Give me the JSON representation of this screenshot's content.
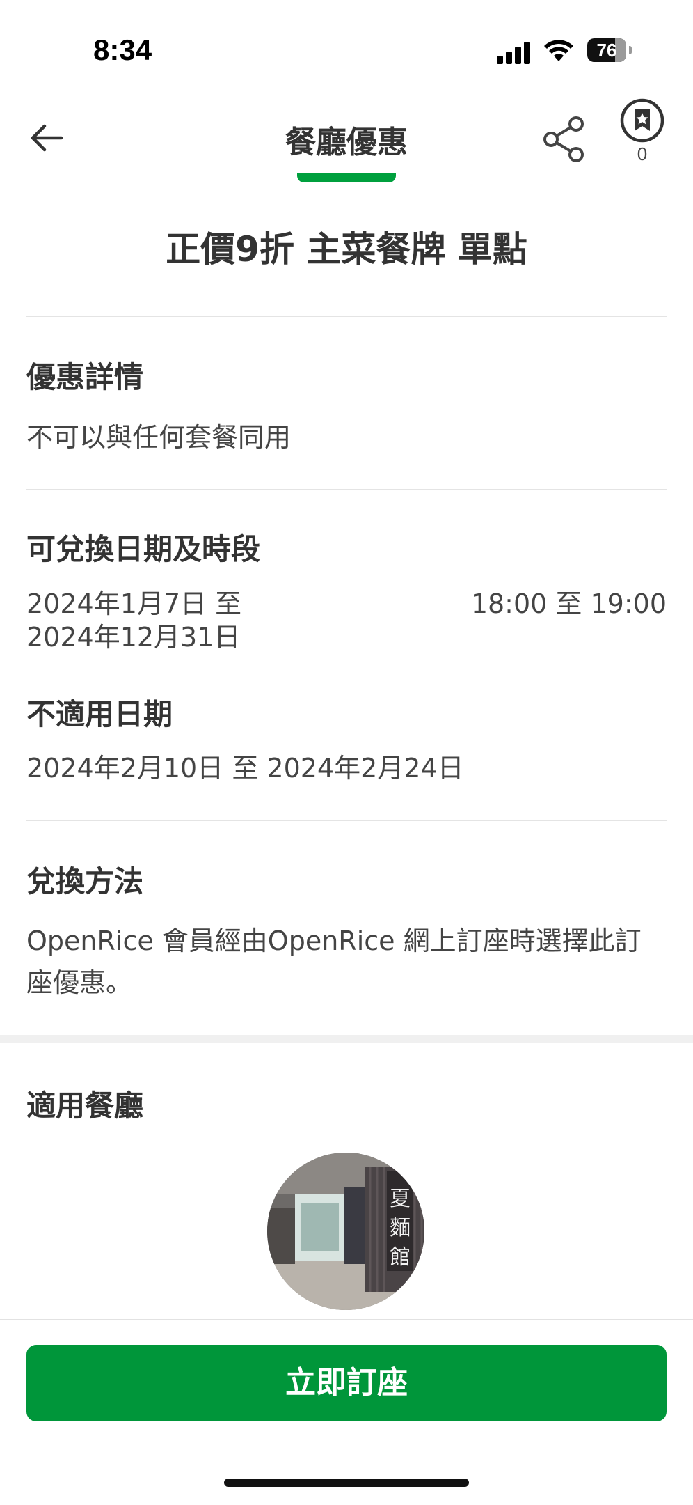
{
  "status_bar": {
    "time": "8:34",
    "battery": "76"
  },
  "nav": {
    "title": "餐廳優惠",
    "bookmark_count": "0"
  },
  "offer": {
    "title": "正價9折 主菜餐牌 單點"
  },
  "details": {
    "heading": "優惠詳情",
    "text": "不可以與任何套餐同用"
  },
  "redeem_period": {
    "heading": "可兌換日期及時段",
    "date_line1": "2024年1月7日 至",
    "date_line2": "2024年12月31日",
    "time_range": "18:00 至 19:00"
  },
  "excluded": {
    "heading": "不適用日期",
    "text": "2024年2月10日 至 2024年2月24日"
  },
  "method": {
    "heading": "兌換方法",
    "line1": "OpenRice 會員經由OpenRice 網上訂座時選擇此訂",
    "line2": "座優惠。"
  },
  "restaurants": {
    "heading": "適用餐廳",
    "sign_text": "夏麵館"
  },
  "footer": {
    "book_label": "立即訂座"
  },
  "colors": {
    "accent": "#00963a"
  },
  "icons": {
    "back": "arrow-left-icon",
    "share": "share-icon",
    "bookmark": "bookmark-icon"
  }
}
